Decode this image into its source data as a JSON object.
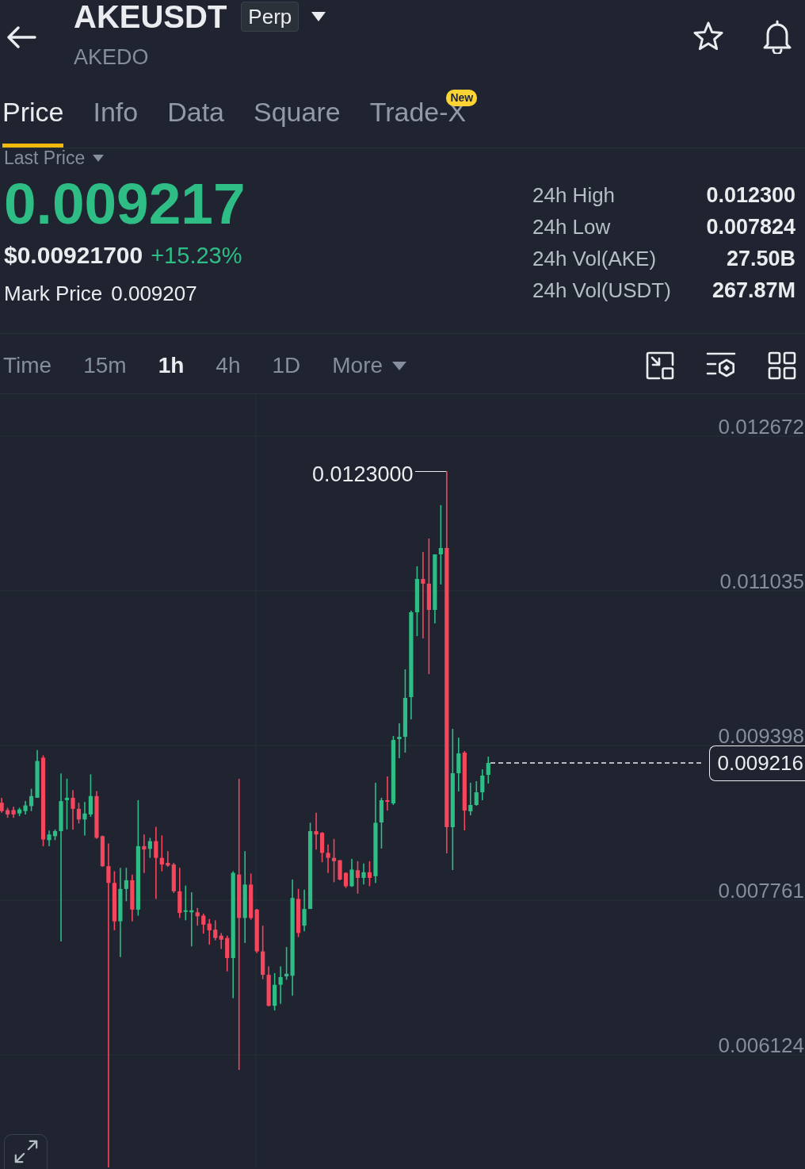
{
  "header": {
    "symbol": "AKEUSDT",
    "contract_badge": "Perp",
    "name": "AKEDO"
  },
  "tabs": [
    {
      "label": "Price",
      "selected": true
    },
    {
      "label": "Info",
      "selected": false
    },
    {
      "label": "Data",
      "selected": false
    },
    {
      "label": "Square",
      "selected": false
    },
    {
      "label": "Trade-X",
      "selected": false,
      "badge": "New"
    }
  ],
  "price_panel": {
    "price_type": "Last Price",
    "rising": true,
    "last_price": "0.009217",
    "usd_price": "$0.00921700",
    "change": "+15.23%",
    "mark_price_label": "Mark Price",
    "mark_price": "0.009207",
    "stats": [
      {
        "label": "24h High",
        "value": "0.012300"
      },
      {
        "label": "24h Low",
        "value": "0.007824"
      },
      {
        "label": "24h Vol(AKE)",
        "value": "27.50B"
      },
      {
        "label": "24h Vol(USDT)",
        "value": "267.87M"
      }
    ]
  },
  "intervals": [
    {
      "label": "Time",
      "selected": false
    },
    {
      "label": "15m",
      "selected": false
    },
    {
      "label": "1h",
      "selected": true
    },
    {
      "label": "4h",
      "selected": false
    },
    {
      "label": "1D",
      "selected": false
    },
    {
      "label": "More",
      "selected": false,
      "dropdown": true
    }
  ],
  "chart": {
    "y_axis_labels": [
      "0.012672",
      "0.011035",
      "0.009398",
      "0.007761",
      "0.006124"
    ],
    "high_label": "0.0123000",
    "current_price": "0.009216"
  }
}
